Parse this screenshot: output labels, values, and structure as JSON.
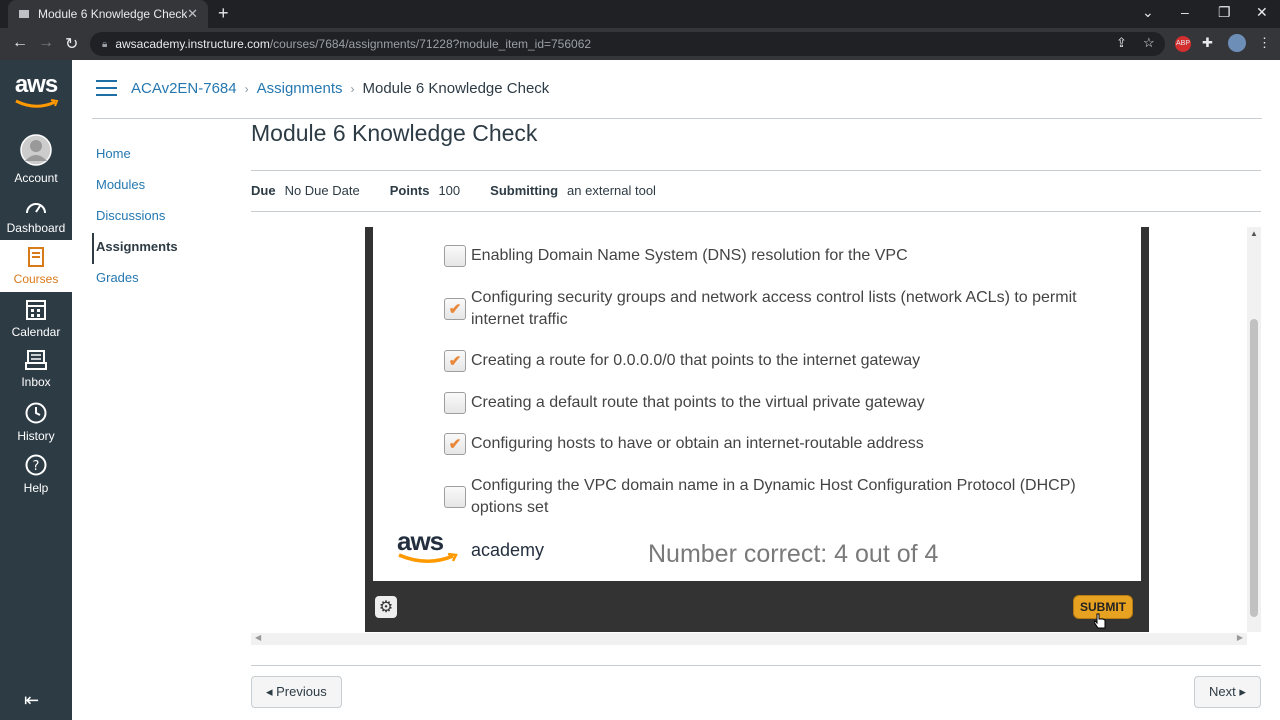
{
  "browser": {
    "tab_title": "Module 6 Knowledge Check",
    "url_host": "awsacademy.instructure.com",
    "url_path": "/courses/7684/assignments/71228?module_item_id=756062"
  },
  "global_nav": {
    "logo": "aws",
    "items": [
      {
        "label": "Account",
        "icon": "account-icon"
      },
      {
        "label": "Dashboard",
        "icon": "dashboard-icon"
      },
      {
        "label": "Courses",
        "icon": "courses-icon"
      },
      {
        "label": "Calendar",
        "icon": "calendar-icon"
      },
      {
        "label": "Inbox",
        "icon": "inbox-icon"
      },
      {
        "label": "History",
        "icon": "history-icon"
      },
      {
        "label": "Help",
        "icon": "help-icon"
      }
    ]
  },
  "breadcrumbs": [
    "ACAv2EN-7684",
    "Assignments",
    "Module 6 Knowledge Check"
  ],
  "course_nav": [
    "Home",
    "Modules",
    "Discussions",
    "Assignments",
    "Grades"
  ],
  "page": {
    "title": "Module 6 Knowledge Check",
    "due_label": "Due",
    "due_value": "No Due Date",
    "points_label": "Points",
    "points_value": "100",
    "submitting_label": "Submitting",
    "submitting_value": "an external tool"
  },
  "quiz": {
    "options": [
      {
        "text": "Enabling Domain Name System (DNS) resolution for the VPC",
        "checked": false
      },
      {
        "text": "Configuring security groups and network access control lists (network ACLs) to permit internet traffic",
        "checked": true
      },
      {
        "text": "Creating a route for 0.0.0.0/0 that points to the internet gateway",
        "checked": true
      },
      {
        "text": "Creating a default route that points to the virtual private gateway",
        "checked": false
      },
      {
        "text": "Configuring hosts to have or obtain an internet-routable address",
        "checked": true
      },
      {
        "text": "Configuring the VPC domain name in a Dynamic Host Configuration Protocol (DHCP) options set",
        "checked": false
      }
    ],
    "logo_main": "aws",
    "logo_sub": "academy",
    "score": "Number correct: 4 out of 4",
    "submit_label": "SUBMIT",
    "accent": "#e8a221"
  },
  "pager": {
    "previous": "◂ Previous",
    "next": "Next ▸"
  },
  "colors": {
    "nav_bg": "#2d3b45",
    "link": "#2578b0",
    "active_course": "#d97a1a"
  }
}
